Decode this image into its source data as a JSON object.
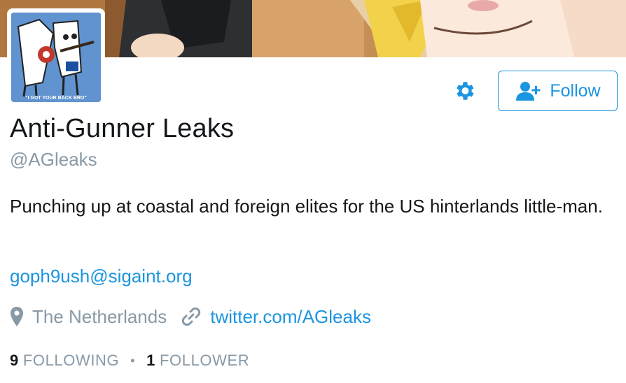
{
  "profile": {
    "name": "Anti-Gunner Leaks",
    "handle": "@AGleaks",
    "bio": "Punching up at coastal and foreign elites for the US hinterlands little-man.",
    "email": "goph9ush@sigaint.org",
    "location": "The Netherlands",
    "url": "twitter.com/AGleaks",
    "avatar_caption": "\"I GOT YOUR BACK BRO\""
  },
  "actions": {
    "follow_label": "Follow",
    "settings_icon": "gear-icon",
    "follow_icon": "add-user-icon"
  },
  "stats": {
    "following_count": "9",
    "following_label": "FOLLOWING",
    "separator": "•",
    "followers_count": "1",
    "followers_label": "FOLLOWER"
  },
  "colors": {
    "accent": "#1b95e0",
    "text": "#14171a",
    "muted": "#8899a6"
  }
}
